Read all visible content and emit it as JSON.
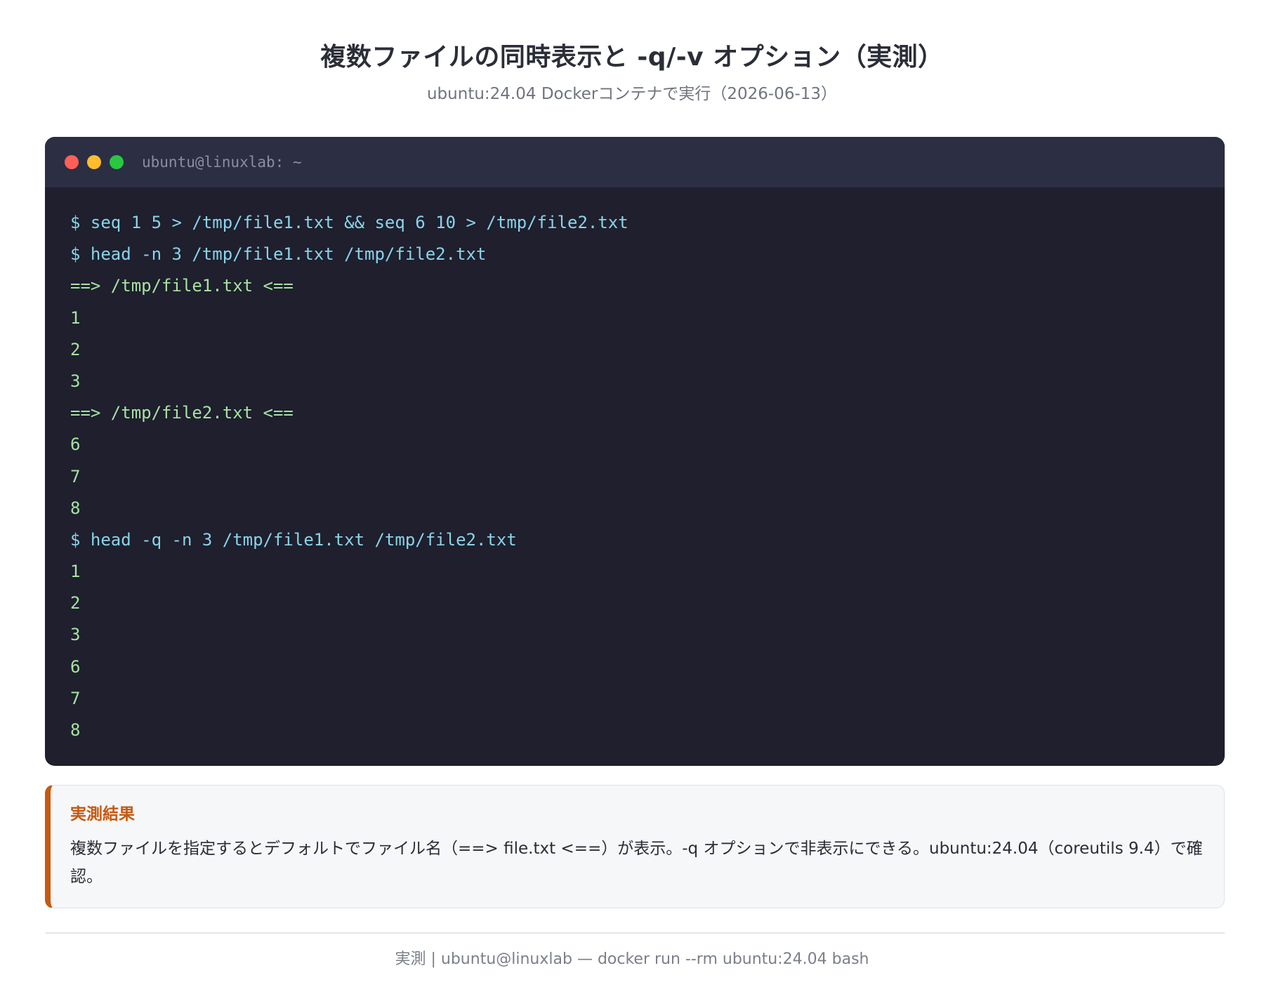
{
  "header": {
    "title": "複数ファイルの同時表示と -q/-v オプション（実測）",
    "subtitle": "ubuntu:24.04 Dockerコンテナで実行（2026-06-13）"
  },
  "terminal": {
    "title": "ubuntu@linuxlab: ~",
    "colors": {
      "background": "#1f1f2e",
      "titlebar": "#2c2e44",
      "command": "#89d4e8",
      "output": "#a6e3a1"
    },
    "lines": [
      {
        "type": "cmd",
        "text": "$ seq 1 5 > /tmp/file1.txt && seq 6 10 > /tmp/file2.txt"
      },
      {
        "type": "cmd",
        "text": "$ head -n 3 /tmp/file1.txt /tmp/file2.txt"
      },
      {
        "type": "out",
        "text": "==> /tmp/file1.txt <=="
      },
      {
        "type": "out",
        "text": "1"
      },
      {
        "type": "out",
        "text": "2"
      },
      {
        "type": "out",
        "text": "3"
      },
      {
        "type": "out",
        "text": "==> /tmp/file2.txt <=="
      },
      {
        "type": "out",
        "text": "6"
      },
      {
        "type": "out",
        "text": "7"
      },
      {
        "type": "out",
        "text": "8"
      },
      {
        "type": "cmd",
        "text": "$ head -q -n 3 /tmp/file1.txt /tmp/file2.txt"
      },
      {
        "type": "out",
        "text": "1"
      },
      {
        "type": "out",
        "text": "2"
      },
      {
        "type": "out",
        "text": "3"
      },
      {
        "type": "out",
        "text": "6"
      },
      {
        "type": "out",
        "text": "7"
      },
      {
        "type": "out",
        "text": "8"
      }
    ]
  },
  "callout": {
    "title": "実測結果",
    "text": "複数ファイルを指定するとデフォルトでファイル名（==> file.txt <==）が表示。-q オプションで非表示にできる。ubuntu:24.04（coreutils 9.4）で確認。",
    "accent_color": "#c55a11"
  },
  "footer": {
    "text": "実測 | ubuntu@linuxlab — docker run --rm ubuntu:24.04 bash"
  }
}
